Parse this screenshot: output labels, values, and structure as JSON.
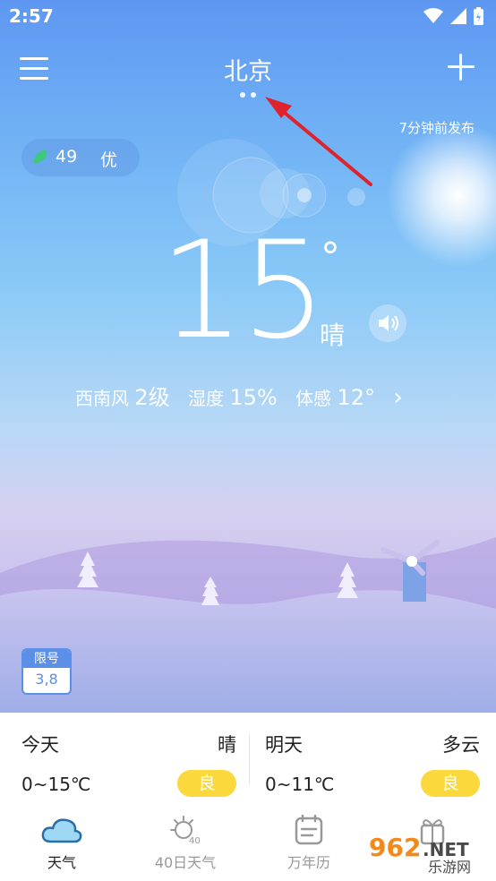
{
  "status": {
    "time": "2:57"
  },
  "header": {
    "city": "北京"
  },
  "publish_time": "7分钟前发布",
  "aqi": {
    "value": "49",
    "level": "优"
  },
  "current": {
    "temperature": "15",
    "degree_symbol": "°",
    "condition": "晴",
    "wind_dir": "西南风",
    "wind_level": "2级",
    "humidity_label": "湿度",
    "humidity": "15%",
    "feels_label": "体感",
    "feels": "12°",
    "more": "›"
  },
  "restriction": {
    "title": "限号",
    "numbers": "3,8"
  },
  "forecast": [
    {
      "day": "今天",
      "weather": "晴",
      "range": "0~15℃",
      "aqi": "良"
    },
    {
      "day": "明天",
      "weather": "多云",
      "range": "0~11℃",
      "aqi": "良"
    }
  ],
  "nav": [
    {
      "label": "天气",
      "icon": "cloud-icon",
      "active": true
    },
    {
      "label": "40日天气",
      "icon": "sun-40-icon",
      "badge": "40"
    },
    {
      "label": "万年历",
      "icon": "calendar-icon"
    },
    {
      "label": "",
      "icon": "gift-icon"
    }
  ],
  "watermark": {
    "logo": "962",
    "suffix": ".NET",
    "text": "乐游网"
  },
  "colors": {
    "accent": "#5b8fe8",
    "aqi_good": "#fbd83c",
    "annotation_arrow": "#e0222b"
  }
}
